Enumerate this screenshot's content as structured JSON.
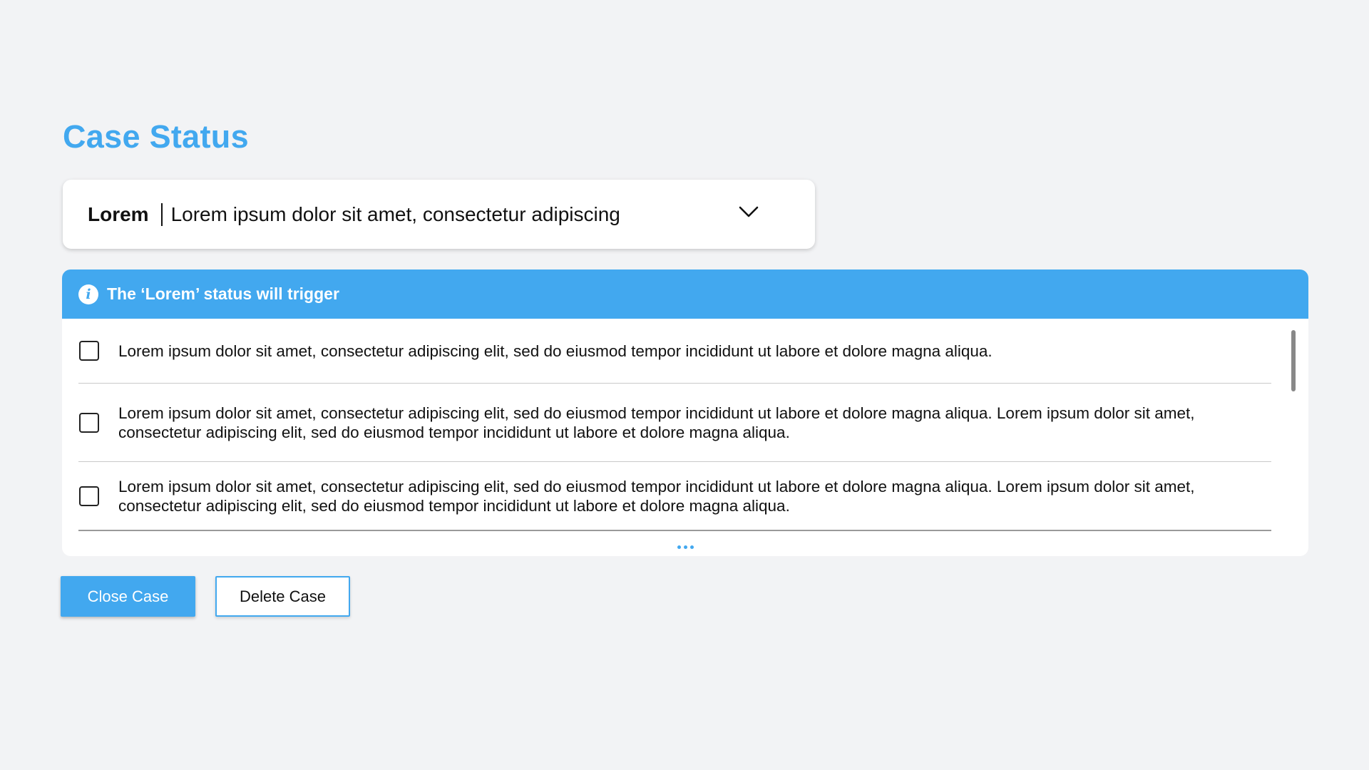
{
  "page": {
    "title": "Case Status"
  },
  "status_select": {
    "code": "Lorem",
    "description": "Lorem ipsum dolor sit amet, consectetur adipiscing",
    "chevron_icon": "chevron-down-icon"
  },
  "trigger_panel": {
    "header_icon": "info-icon",
    "header_title": "The ‘Lorem’ status will trigger",
    "items": [
      {
        "checked": false,
        "text": "Lorem ipsum dolor sit amet, consectetur adipiscing elit, sed do eiusmod tempor incididunt ut labore et dolore magna aliqua."
      },
      {
        "checked": false,
        "text": "Lorem ipsum dolor sit amet, consectetur adipiscing elit, sed do eiusmod tempor incididunt ut labore et dolore magna aliqua. Lorem ipsum dolor sit amet, consectetur adipiscing elit, sed do eiusmod tempor incididunt ut labore et dolore magna aliqua."
      },
      {
        "checked": false,
        "text": "Lorem ipsum dolor sit amet, consectetur adipiscing elit, sed do eiusmod tempor incididunt ut labore et dolore magna aliqua. Lorem ipsum dolor sit amet, consectetur adipiscing elit, sed do eiusmod tempor incididunt ut labore et dolore magna aliqua."
      }
    ],
    "more_icon": "more-horizontal-icon"
  },
  "actions": {
    "close_label": "Close Case",
    "delete_label": "Delete Case"
  },
  "colors": {
    "accent": "#42a8ef",
    "background": "#f2f3f5"
  }
}
